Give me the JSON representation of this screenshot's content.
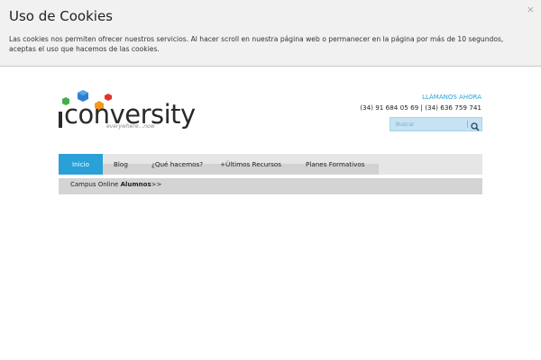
{
  "cookies": {
    "title": "Uso de Cookies",
    "text": "Las cookies nos permiten ofrecer nuestros servicios. Al hacer scroll en nuestra página web o permanecer en la página por más de 10 segundos, aceptas el uso que hacemos de las cookies.",
    "close_label": "×"
  },
  "logo": {
    "wordmark": "conversity",
    "tagline": "everywhere...now"
  },
  "contact": {
    "cta": "LLÁMANOS AHORA",
    "phones": "(34) 91 684 05 69 | (34) 636 759 741"
  },
  "search": {
    "placeholder": "Buscar"
  },
  "nav": {
    "items": [
      {
        "label": "Inicio",
        "active": true
      },
      {
        "label": "Blog"
      },
      {
        "label": "¿Qué hacemos?"
      },
      {
        "label": "+Últimos Recursos"
      },
      {
        "label": "Planes Formativos"
      }
    ]
  },
  "subnav": {
    "prefix": "Campus Online ",
    "strong": "Alumnos",
    "suffix": ">>"
  },
  "colors": {
    "accent": "#2aa0d8",
    "logo_blue": "#2f7fd0",
    "logo_green": "#3fb04a",
    "logo_orange": "#f39a1d",
    "logo_red": "#e2332e"
  }
}
